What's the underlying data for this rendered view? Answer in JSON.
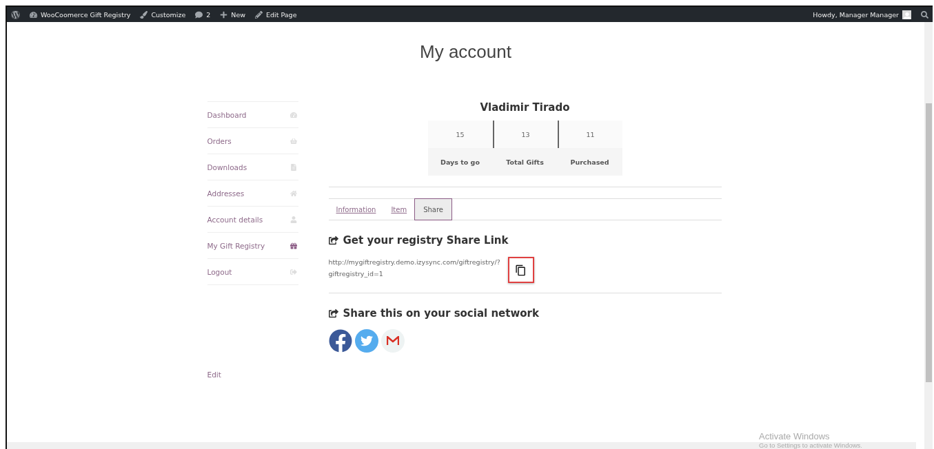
{
  "admin_bar": {
    "items": [
      {
        "label": "WooCoomerce Gift Registry"
      },
      {
        "label": "Customize"
      },
      {
        "label": "2"
      },
      {
        "label": "New"
      },
      {
        "label": "Edit Page"
      }
    ],
    "greeting": "Howdy, Manager Manager"
  },
  "page_title": "My account",
  "account_nav": [
    {
      "label": "Dashboard",
      "selected": false
    },
    {
      "label": "Orders",
      "selected": false
    },
    {
      "label": "Downloads",
      "selected": false
    },
    {
      "label": "Addresses",
      "selected": false
    },
    {
      "label": "Account details",
      "selected": false
    },
    {
      "label": "My Gift Registry",
      "selected": true
    },
    {
      "label": "Logout",
      "selected": false
    }
  ],
  "edit_link": "Edit",
  "profile": {
    "name": "Vladimir Tirado",
    "stats": [
      {
        "value": "15",
        "label": "Days to go"
      },
      {
        "value": "13",
        "label": "Total Gifts"
      },
      {
        "value": "11",
        "label": "Purchased"
      }
    ]
  },
  "tabs": [
    {
      "label": "Information",
      "selected": false
    },
    {
      "label": "Item",
      "selected": false
    },
    {
      "label": "Share",
      "selected": true
    }
  ],
  "share_link": {
    "heading": "Get your registry Share Link",
    "url": "http://mygiftregistry.demo.izysync.com/giftregistry/?giftregistry_id=1"
  },
  "social": {
    "heading": "Share this on your social network"
  },
  "os_notice": {
    "title": "Activate Windows",
    "subtitle": "Go to Settings to activate Windows."
  }
}
